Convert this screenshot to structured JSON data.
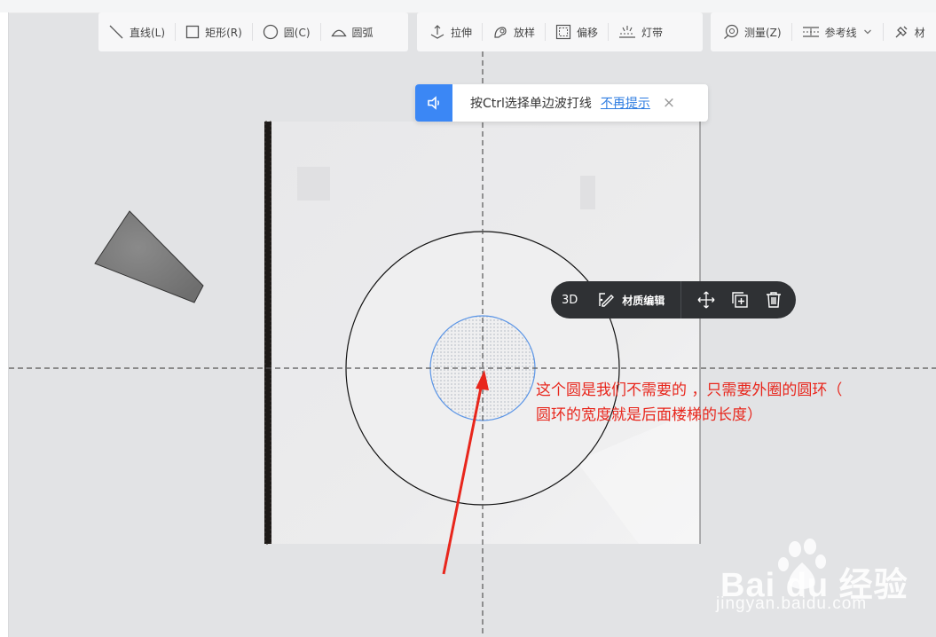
{
  "toolbar": {
    "group1": [
      {
        "icon": "line-icon",
        "label": "直线(L)"
      },
      {
        "icon": "rectangle-icon",
        "label": "矩形(R)"
      },
      {
        "icon": "circle-icon",
        "label": "圆(C)"
      },
      {
        "icon": "arc-icon",
        "label": "圆弧"
      }
    ],
    "group2": [
      {
        "icon": "extrude-icon",
        "label": "拉伸"
      },
      {
        "icon": "loft-icon",
        "label": "放样"
      },
      {
        "icon": "offset-icon",
        "label": "偏移"
      },
      {
        "icon": "light-strip-icon",
        "label": "灯带"
      }
    ],
    "group3": [
      {
        "icon": "measure-icon",
        "label": "测量(Z)"
      },
      {
        "icon": "reference-line-icon",
        "label": "参考线"
      },
      {
        "icon": "material-brush-icon",
        "label": "材"
      }
    ]
  },
  "hint": {
    "text": "按Ctrl选择单边波打线",
    "link": "不再提示",
    "close": "×"
  },
  "context_toolbar": {
    "view_3d": "3D",
    "material_edit": "材质编辑"
  },
  "annotation": {
    "line1": "这个圆是我们不需要的 ，只需要外圈的圆环（",
    "line2": "圆环的宽度就是后面楼梯的长度）"
  },
  "watermark": {
    "brand": "Bai du 经验",
    "url": "jingyan.baidu.com"
  },
  "colors": {
    "accent": "#3b87f5",
    "annotation_red": "#e8261c",
    "selection_blue": "#5b95e6",
    "context_bg": "#2f3134"
  }
}
